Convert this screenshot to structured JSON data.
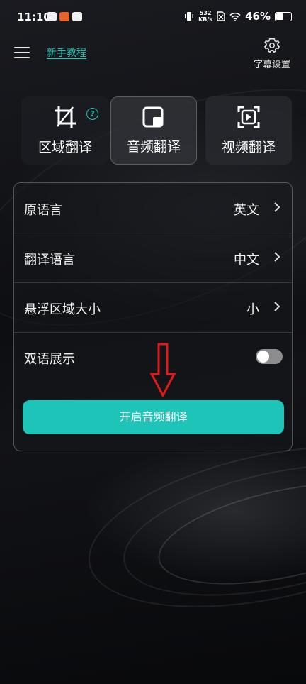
{
  "status_bar": {
    "time": "11:10",
    "net_speed_value": "532",
    "net_speed_unit": "KB/s",
    "battery": "46%",
    "battery_level": 0.46
  },
  "header": {
    "tutorial_link": "新手教程",
    "subtitle_settings": "字幕设置"
  },
  "modes": [
    {
      "label": "区域翻译",
      "icon": "crop-icon"
    },
    {
      "label": "音频翻译",
      "icon": "audio-window-icon"
    },
    {
      "label": "视频翻译",
      "icon": "video-play-icon"
    }
  ],
  "help_glyph": "?",
  "settings": {
    "source_language": {
      "label": "原语言",
      "value": "英文"
    },
    "target_language": {
      "label": "翻译语言",
      "value": "中文"
    },
    "float_area_size": {
      "label": "悬浮区域大小",
      "value": "小"
    },
    "bilingual_display": {
      "label": "双语展示",
      "enabled": false
    }
  },
  "start_button": "开启音频翻译",
  "colors": {
    "accent": "#1ec4b8",
    "annotation_arrow": "#e0191d"
  }
}
